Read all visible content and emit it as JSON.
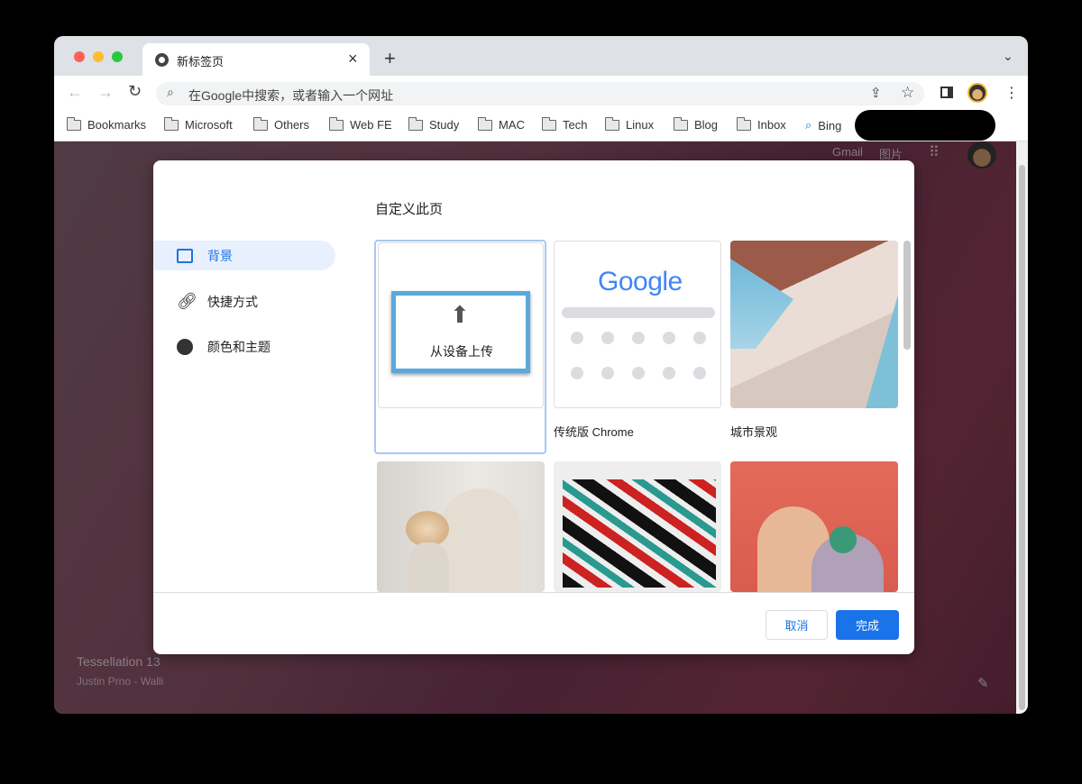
{
  "window": {
    "traffic_lights": [
      "#ff5f57",
      "#febc2e",
      "#28c840"
    ]
  },
  "tab": {
    "title": "新标签页",
    "close": "×",
    "new_tab": "+"
  },
  "toolbar": {
    "omnibox_placeholder": "在Google中搜索，或者输入一个网址"
  },
  "bookmarks": [
    "Bookmarks",
    "Microsoft",
    "Others",
    "Web FE",
    "Study",
    "MAC",
    "Tech",
    "Linux",
    "Blog",
    "Inbox"
  ],
  "bing": "Bing",
  "ntp": {
    "gmail": "Gmail",
    "images": "图片",
    "bg_title": "Tessellation 13",
    "bg_author": "Justin Prno - Walli"
  },
  "dialog": {
    "title": "自定义此页",
    "sidebar": [
      {
        "label": "背景",
        "icon": "image-icon",
        "selected": true
      },
      {
        "label": "快捷方式",
        "icon": "link-icon",
        "selected": false
      },
      {
        "label": "颜色和主题",
        "icon": "palette-icon",
        "selected": false
      }
    ],
    "upload_label": "从设备上传",
    "tiles": [
      {
        "label": "传统版 Chrome"
      },
      {
        "label": "城市景观"
      }
    ],
    "google_logo": "Google",
    "cancel": "取消",
    "done": "完成",
    "accent": "#1a73e8"
  }
}
